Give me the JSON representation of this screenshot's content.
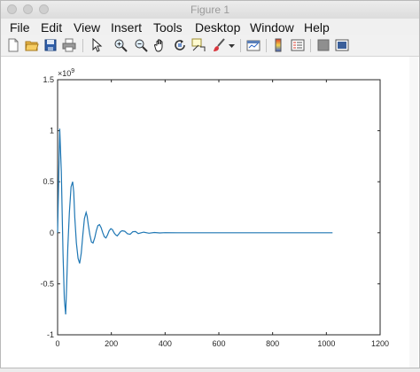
{
  "window": {
    "title": "Figure 1"
  },
  "menu": [
    "File",
    "Edit",
    "View",
    "Insert",
    "Tools",
    "Desktop",
    "Window",
    "Help"
  ],
  "toolbar": [
    {
      "name": "new-figure-icon"
    },
    {
      "name": "open-file-icon"
    },
    {
      "name": "save-icon"
    },
    {
      "name": "print-icon"
    },
    {
      "name": "pointer-icon"
    },
    {
      "name": "zoom-in-icon"
    },
    {
      "name": "zoom-out-icon"
    },
    {
      "name": "pan-hand-icon"
    },
    {
      "name": "rotate-3d-icon"
    },
    {
      "name": "data-cursor-icon"
    },
    {
      "name": "brush-icon"
    },
    {
      "name": "brush-dropdown-icon"
    },
    {
      "name": "link-plot-icon"
    },
    {
      "name": "colorbar-icon"
    },
    {
      "name": "legend-icon"
    },
    {
      "name": "hide-plot-tools-icon"
    },
    {
      "name": "show-plot-tools-icon"
    }
  ],
  "chart_data": {
    "type": "line",
    "title": "",
    "xlabel": "",
    "ylabel": "",
    "xlim": [
      0,
      1200
    ],
    "ylim": [
      -1.0,
      1.5
    ],
    "y_exponent_label": "×10",
    "y_exponent_power": "9",
    "xticks": [
      "0",
      "200",
      "400",
      "600",
      "800",
      "1000",
      "1200"
    ],
    "yticks": [
      "-1",
      "-0.5",
      "0",
      "0.5",
      "1",
      "1.5"
    ],
    "grid": false,
    "line_color": "#1f77b4",
    "x": [
      0,
      8,
      14,
      20,
      25,
      30,
      34,
      38,
      44,
      50,
      56,
      60,
      64,
      70,
      76,
      82,
      88,
      94,
      100,
      106,
      110,
      114,
      120,
      126,
      132,
      138,
      144,
      150,
      156,
      162,
      168,
      174,
      180,
      186,
      192,
      198,
      204,
      210,
      216,
      222,
      228,
      234,
      240,
      250,
      260,
      270,
      280,
      290,
      300,
      320,
      340,
      360,
      380,
      400,
      450,
      500,
      600,
      700,
      800,
      900,
      1000,
      1023
    ],
    "y": [
      0.0,
      1.02,
      0.6,
      -0.2,
      -0.65,
      -0.8,
      -0.5,
      -0.15,
      0.2,
      0.45,
      0.5,
      0.4,
      0.15,
      -0.1,
      -0.25,
      -0.3,
      -0.2,
      -0.02,
      0.14,
      0.2,
      0.16,
      0.08,
      -0.02,
      -0.09,
      -0.1,
      -0.05,
      0.02,
      0.07,
      0.08,
      0.05,
      0.0,
      -0.04,
      -0.05,
      -0.02,
      0.02,
      0.04,
      0.03,
      0.0,
      -0.02,
      -0.03,
      -0.01,
      0.01,
      0.02,
      0.015,
      -0.01,
      -0.015,
      0.01,
      0.012,
      -0.008,
      0.006,
      -0.004,
      0.003,
      -0.002,
      0.001,
      0.0,
      0.0,
      0.0,
      0.0,
      0.0,
      0.0,
      0.0,
      0.0
    ]
  }
}
